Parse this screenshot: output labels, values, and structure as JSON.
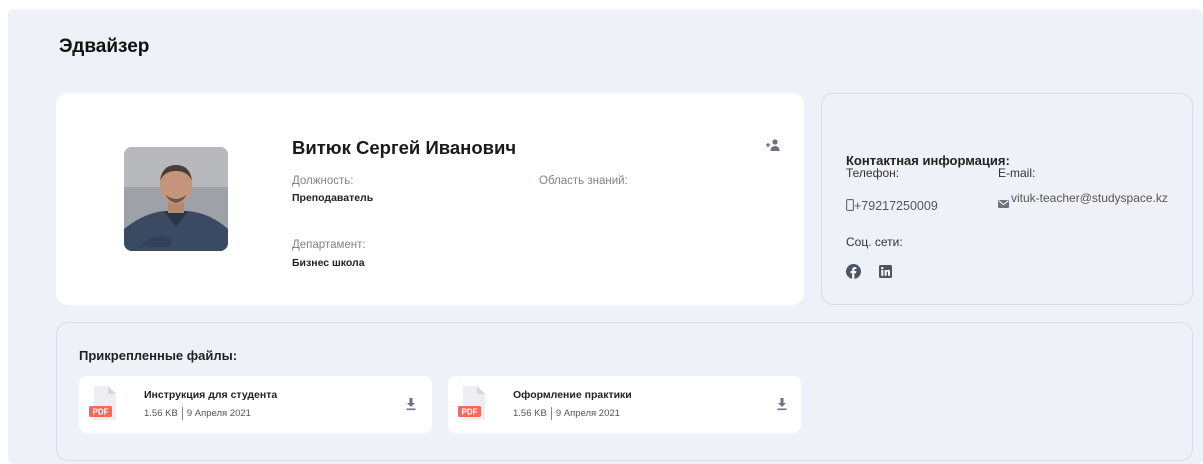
{
  "page": {
    "title": "Эдвайзер"
  },
  "profile": {
    "name": "Витюк Сергей Иванович",
    "position_label": "Должность:",
    "position_value": "Преподаватель",
    "knowledge_label": "Область знаний:",
    "knowledge_value": "",
    "department_label": "Департамент:",
    "department_value": "Бизнес школа",
    "icons": {
      "avatar": "advisor-photo",
      "action": "user-follow-icon"
    }
  },
  "contacts": {
    "title": "Контактная информация:",
    "phone_label": "Телефон:",
    "phone_value": "+79217250009",
    "email_label": "E-mail:",
    "email_value": "vituk-teacher@studyspace.kz",
    "social_label": "Соц. сети:",
    "social": [
      "facebook-icon",
      "linkedin-icon"
    ]
  },
  "files": {
    "title": "Прикрепленные файлы:",
    "items": [
      {
        "badge": "PDF",
        "name": "Инструкция для студента",
        "size": "1.56 KB",
        "date": "9 Апреля 2021"
      },
      {
        "badge": "PDF",
        "name": "Оформление практики",
        "size": "1.56 KB",
        "date": "9 Апреля 2021"
      }
    ]
  },
  "colors": {
    "background": "#eef1f7",
    "card": "#ffffff",
    "pdf_badge": "#f26a5b",
    "border": "#d9dde6"
  }
}
